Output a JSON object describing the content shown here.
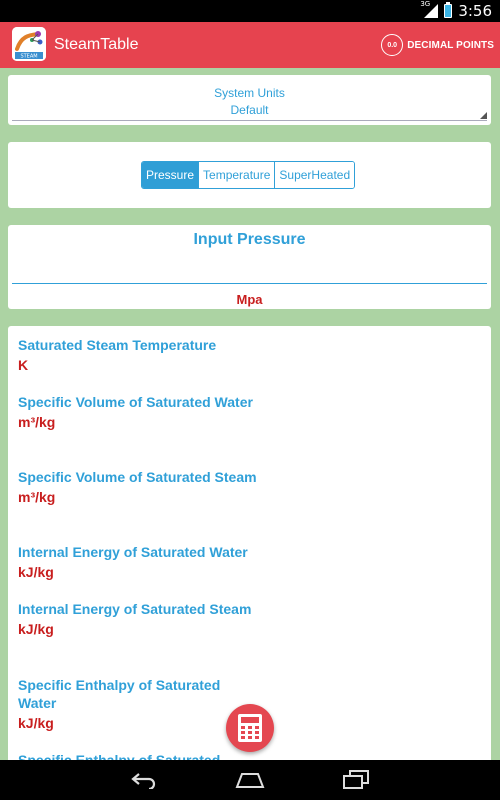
{
  "status_bar": {
    "time": "3:56",
    "network": "3G"
  },
  "app_bar": {
    "title": "SteamTable",
    "decimal_points_label": "DECIMAL POINTS",
    "decimal_icon_text": "0.0",
    "logo_text": "STEAM"
  },
  "system_units": {
    "label": "System Units",
    "value": "Default"
  },
  "tabs": [
    {
      "label": "Pressure",
      "active": true
    },
    {
      "label": "Temperature",
      "active": false
    },
    {
      "label": "SuperHeated",
      "active": false
    }
  ],
  "input": {
    "title": "Input Pressure",
    "value": "",
    "unit": "Mpa"
  },
  "results": [
    {
      "label": "Saturated Steam Temperature",
      "unit": "K"
    },
    {
      "label": "Specific Volume of Saturated Water",
      "unit": "m³/kg"
    },
    {
      "label": "Specific Volume of Saturated Steam",
      "unit": "m³/kg"
    },
    {
      "label": "Internal Energy of Saturated Water",
      "unit": "kJ/kg"
    },
    {
      "label": "Internal Energy of Saturated Steam",
      "unit": "kJ/kg"
    },
    {
      "label": "Specific Enthalpy of Saturated Water",
      "unit": "kJ/kg"
    },
    {
      "label": "Specific Enthalpy of Saturated",
      "unit": ""
    }
  ],
  "icons": {
    "fab": "calculator-icon",
    "nav_back": "back-icon",
    "nav_home": "home-icon",
    "nav_recents": "recents-icon",
    "decimal": "decimal-points-icon"
  },
  "colors": {
    "app_bar": "#e6434f",
    "accent": "#30a0d8",
    "unit_red": "#c81e1e",
    "background": "#acd3a3"
  }
}
